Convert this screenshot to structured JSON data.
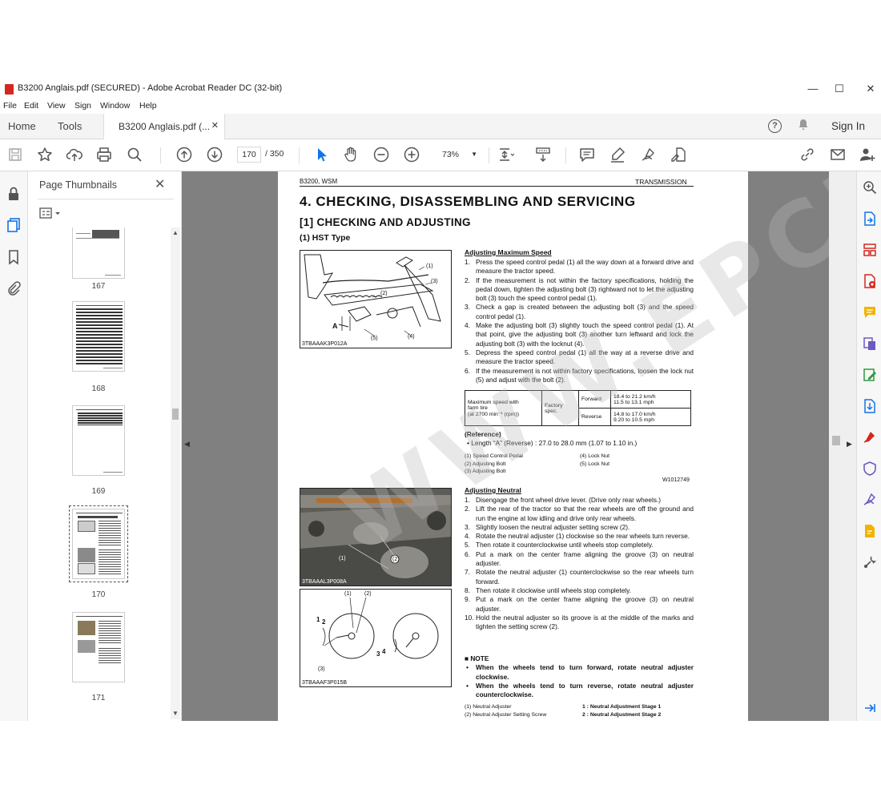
{
  "window": {
    "title": "B3200 Anglais.pdf (SECURED) - Adobe Acrobat Reader DC (32-bit)",
    "minimize": "—",
    "maximize": "☐",
    "close": "✕"
  },
  "menu": [
    "File",
    "Edit",
    "View",
    "Sign",
    "Window",
    "Help"
  ],
  "tabs": {
    "home": "Home",
    "tools": "Tools",
    "document": "B3200 Anglais.pdf (...",
    "close": "✕",
    "help": "?",
    "signin": "Sign In"
  },
  "toolbar": {
    "current_page": "170",
    "page_of": "/  350",
    "zoom": "73%"
  },
  "thumbnails": {
    "title": "Page Thumbnails",
    "close": "✕",
    "pages": [
      {
        "num": "167",
        "selected": false
      },
      {
        "num": "168",
        "selected": false
      },
      {
        "num": "169",
        "selected": false
      },
      {
        "num": "170",
        "selected": true
      },
      {
        "num": "171",
        "selected": false
      }
    ]
  },
  "page": {
    "header_left": "B3200, WSM",
    "header_right": "TRANSMISSION",
    "h1": "4.  CHECKING,  DISASSEMBLING  AND  SERVICING",
    "h2": "[1]  CHECKING  AND  ADJUSTING",
    "h3": "(1)  HST Type",
    "fig1_caption": "3TBAAAK3P012A",
    "fig2_caption": "3TBAAAL3P008A",
    "fig3_caption": "3TBAAAF3P015B",
    "fig1_labels": [
      "(1)",
      "(3)",
      "(2)",
      "A",
      "(5)",
      "(4)"
    ],
    "fig2_labels": [
      "(1)",
      "(2)"
    ],
    "fig3_labels": [
      "(1)",
      "(2)",
      "1",
      "2",
      "(3)",
      "3",
      "4"
    ],
    "section1": {
      "title": "Adjusting Maximum Speed",
      "steps": [
        {
          "n": "1.",
          "t": "Press the speed control pedal (1) all the way down at a forward drive and measure the tractor speed."
        },
        {
          "n": "2.",
          "t": "If the measurement is not within the factory specifications, holding the pedal down, tighten the adjusting bolt (3) rightward not to let the adjusting bolt (3) touch the speed control pedal (1)."
        },
        {
          "n": "3.",
          "t": "Check a gap is created between the adjusting bolt (3) and the speed control pedal (1)."
        },
        {
          "n": "4.",
          "t": "Make the adjusting bolt (3) slightly touch the speed control pedal (1).  At that point, give the adjusting bolt (3) another turn leftward and lock the adjusting bolt (3) with the locknut (4)."
        },
        {
          "n": "5.",
          "t": "Depress the speed control pedal (1) all the way at a reverse drive and measure the tractor speed."
        },
        {
          "n": "6.",
          "t": "If the measurement is not within factory specifications, loosen the lock nut (5) and adjust with the bolt (2)."
        }
      ],
      "spec": {
        "label_line1": "Maximum speed with",
        "label_line2": "farm tire",
        "label_line3": "(at 2700 min⁻¹ (rpm))",
        "factory": "Factory spec.",
        "forward": "Forward",
        "forward_v1": "18.4 to 21.2 km/h",
        "forward_v2": "11.5 to 13.1 mph",
        "reverse": "Reverse",
        "reverse_v1": "14.8 to 17.0 km/h",
        "reverse_v2": "9.20 to 10.5 mph"
      },
      "reference_title": "(Reference)",
      "reference_item": "•  Length “A” (Reverse) : 27.0 to 28.0 mm (1.07 to 1.10 in.)",
      "legend_left": [
        "(1)  Speed Control Pedal",
        "(2)  Adjusting Bolt",
        "(3)  Adjusting Bolt"
      ],
      "legend_right": [
        "(4)  Lock Nut",
        "(5)  Lock Nut"
      ],
      "code": "W1012749"
    },
    "section2": {
      "title": "Adjusting Neutral",
      "steps": [
        {
          "n": "1.",
          "t": "Disengage the front wheel drive lever.  (Drive only rear wheels.)"
        },
        {
          "n": "2.",
          "t": "Lift the rear of the tractor so that the rear wheels are off the ground and run the engine at low idling and drive only rear wheels."
        },
        {
          "n": "3.",
          "t": "Slightly loosen the neutral adjuster setting screw (2)."
        },
        {
          "n": "4.",
          "t": "Rotate the neutral adjuster (1) clockwise so the rear wheels turn reverse."
        },
        {
          "n": "5.",
          "t": "Then rotate it counterclockwise until wheels stop completely."
        },
        {
          "n": "6.",
          "t": "Put a mark on the center frame aligning the groove (3) on neutral adjuster."
        },
        {
          "n": "7.",
          "t": "Rotate the neutral adjuster (1) counterclockwise so the rear wheels turn forward."
        },
        {
          "n": "8.",
          "t": "Then rotate it clockwise until wheels stop completely."
        },
        {
          "n": "9.",
          "t": "Put a mark on the center frame aligning the groove (3) on neutral adjuster."
        },
        {
          "n": "10.",
          "t": "Hold the neutral adjuster so its groove is at the middle of the marks and tighten the setting screw (2)."
        }
      ],
      "note_title": "■  NOTE",
      "notes": [
        "When the wheels tend to turn forward, rotate neutral adjuster clockwise.",
        "When the wheels tend to turn reverse, rotate neutral adjuster counterclockwise."
      ],
      "legend_left": [
        "(1)  Neutral Adjuster",
        "(2)  Neutral Adjuster Setting Screw"
      ],
      "legend_right": [
        "1 : Neutral Adjustment Stage 1",
        "2 : Neutral Adjustment Stage 2"
      ]
    },
    "watermark": "WWW.EPCDDS.COM"
  },
  "colors": {
    "acrobat_red": "#d4271f",
    "doc_bg": "#808080",
    "accent_blue": "#1473e6",
    "tool_purple": "#6e5ac0"
  }
}
